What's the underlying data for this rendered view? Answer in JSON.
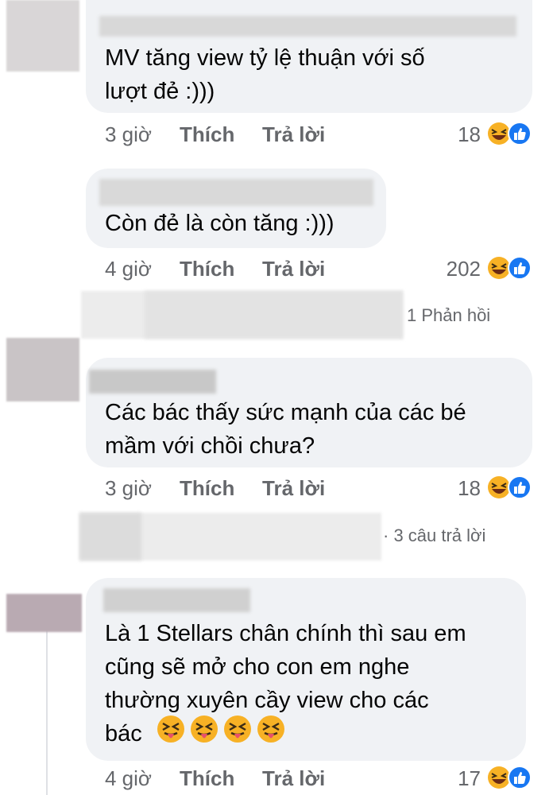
{
  "comments": [
    {
      "text": "MV tăng view tỷ lệ thuận với số\nlượt đẻ :)))",
      "time": "3 giờ",
      "like_label": "Thích",
      "reply_label": "Trả lời",
      "reaction_count": "18"
    },
    {
      "text": "Còn đẻ là còn tăng :)))",
      "time": "4 giờ",
      "like_label": "Thích",
      "reply_label": "Trả lời",
      "reaction_count": "202"
    },
    {
      "text": "Các bác thấy sức mạnh của các bé\nmầm với chồi chưa?",
      "time": "3 giờ",
      "like_label": "Thích",
      "reply_label": "Trả lời",
      "reaction_count": "18"
    },
    {
      "text": "Là 1 Stellars chân chính thì sau em\ncũng sẽ mở cho con em nghe\nthường xuyên cầy view cho các\nbác",
      "time": "4 giờ",
      "like_label": "Thích",
      "reply_label": "Trả lời",
      "reaction_count": "17"
    }
  ],
  "replies": {
    "first": "1 Phản hồi",
    "second": "· 3 câu trả lời"
  },
  "icons": {
    "reaction_laugh": "laugh-emoji-icon",
    "reaction_like": "like-icon",
    "tongue": "squinting-tongue-emoji-icon"
  },
  "colors": {
    "bubble": "#f0f2f5",
    "meta_text": "#65676b",
    "like_blue": "#1877f2",
    "laugh_yellow": "#f7b125"
  }
}
